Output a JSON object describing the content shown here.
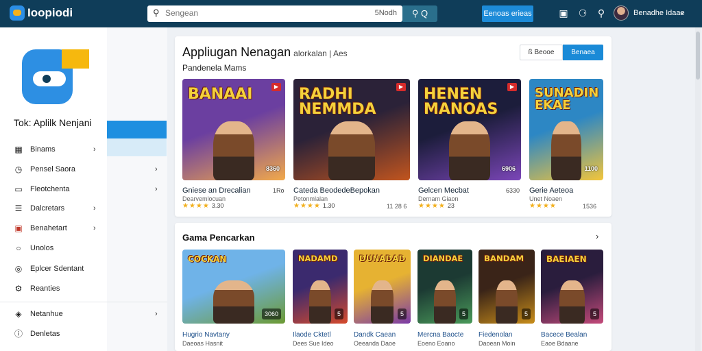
{
  "topbar": {
    "logo_text": "Ioopiodi",
    "search_placeholder": "Sengean",
    "search_hint": "5Nodh",
    "search_button": "⚲ Q",
    "install_button": "Eenoas erieas",
    "user_name": "Benadhe Idaae"
  },
  "sidebar": {
    "app_name": "Tok: Aplilk Nenjani",
    "items": [
      {
        "label": "Binams",
        "icon": "grid-icon"
      },
      {
        "label": "Pensel Saora",
        "icon": "clock-icon"
      },
      {
        "label": "Fleotchenta",
        "icon": "folder-icon"
      },
      {
        "label": "Dalcretars",
        "icon": "list-icon"
      },
      {
        "label": "Benahetart",
        "icon": "shop-icon"
      },
      {
        "label": "Unolos",
        "icon": "circle-icon"
      },
      {
        "label": "Eplcer Sdentant",
        "icon": "compass-icon"
      },
      {
        "label": "Reanties",
        "icon": "settings-icon"
      },
      {
        "label": "Netanhue",
        "icon": "diamond-icon"
      },
      {
        "label": "Denletas",
        "icon": "info-icon"
      }
    ]
  },
  "featured": {
    "title": "Appliugan Nenagan",
    "title_suffix": "alorkalan | Aes",
    "subtitle": "Pandenela Mams",
    "btn_outline": "ß Beooe",
    "btn_primary": "Benaea",
    "games": [
      {
        "art": "BANAAI",
        "name": "Gniese an Drecalian",
        "side": "1Ro",
        "meta": "Dearvemlocuan",
        "rating": "3.30",
        "right": "",
        "price": "8360",
        "bg": "#6b3fa0",
        "bg2": "#f2a94a"
      },
      {
        "art": "RADHI NEMMDA",
        "name": "Cateda BeodedeBepokan",
        "side": "",
        "meta": "Petonmlalan",
        "rating": "1.30",
        "right": "11 28 6",
        "price": "",
        "bg": "#2b2238",
        "bg2": "#c2551e"
      },
      {
        "art": "HENEN MANOAS",
        "name": "Gelcen Mecbat",
        "side": "6330",
        "meta": "Dernam Giaon",
        "rating": "23",
        "right": "",
        "price": "6906",
        "bg": "#1c1d3b",
        "bg2": "#7b46b8"
      },
      {
        "art": "SUNADIN EKAE",
        "name": "Gerie Aeteoa",
        "side": "",
        "meta": "Unet Noaen",
        "rating": "",
        "right": "1536",
        "price": "1100",
        "bg": "#2d87c4",
        "bg2": "#f3c53a"
      }
    ]
  },
  "section2": {
    "title": "Gama Pencarkan",
    "games": [
      {
        "art": "COCKAN",
        "name": "Hugrio Navtany",
        "meta": "Daeoas Hasnit",
        "tag": "3060",
        "bg": "#6fb3e8",
        "bg2": "#6c9a33"
      },
      {
        "art": "NADAMD",
        "name": "Ilaode Cktetl",
        "meta": "Dees Sue Ideo",
        "tag": "5",
        "bg": "#3b2a6e",
        "bg2": "#d64a2c"
      },
      {
        "art": "DUNADAD",
        "name": "Dandk Caean",
        "meta": "Oeeanda Daoe",
        "tag": "5",
        "bg": "#e6b232",
        "bg2": "#7a3aa8"
      },
      {
        "art": "DIANDAE",
        "name": "Mercna Baocte",
        "meta": "Eoeno Eoano",
        "tag": "5",
        "bg": "#1c3a33",
        "bg2": "#4a9a5a"
      },
      {
        "art": "BANDAM",
        "name": "Fiedenolan",
        "meta": "Daoean Moin",
        "tag": "5",
        "bg": "#3a2418",
        "bg2": "#c88d1a"
      },
      {
        "art": "BAEIAEN",
        "name": "Bacece Bealan",
        "meta": "Eaoe Bdaane",
        "tag": "5",
        "bg": "#2a1d3d",
        "bg2": "#c44a7a"
      }
    ]
  }
}
